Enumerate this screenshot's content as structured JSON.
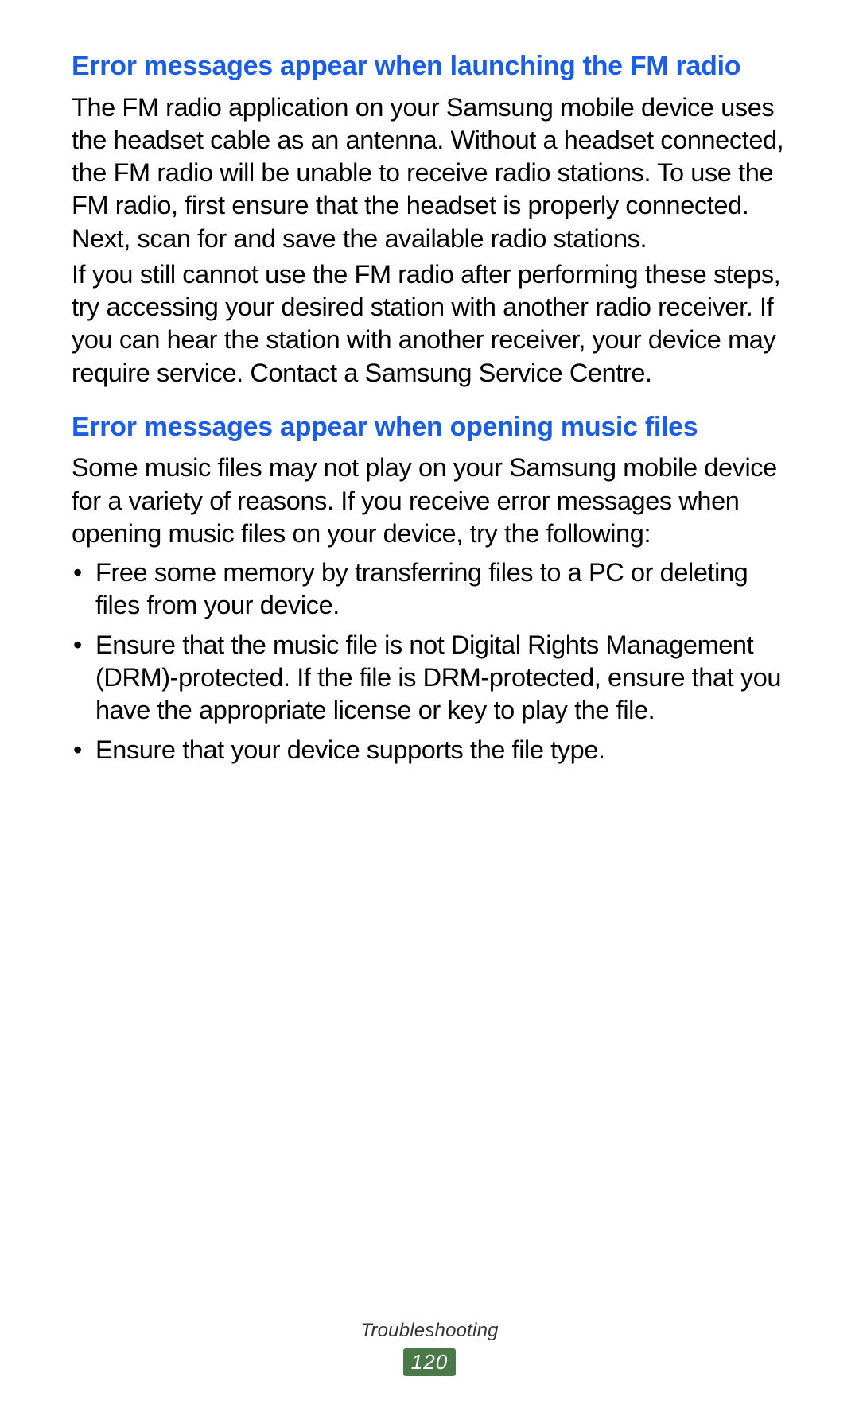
{
  "sections": [
    {
      "heading": "Error messages appear when launching the FM radio",
      "paragraphs": [
        "The FM radio application on your Samsung mobile device uses the headset cable as an antenna. Without a headset connected, the FM radio will be unable to receive radio stations. To use the FM radio, first ensure that the headset is properly connected. Next, scan for and save the available radio stations.",
        "If you still cannot use the FM radio after performing these steps, try accessing your desired station with another radio receiver. If you can hear the station with another receiver, your device may require service. Contact a Samsung Service Centre."
      ]
    },
    {
      "heading": "Error messages appear when opening music files",
      "paragraphs": [
        "Some music files may not play on your Samsung mobile device for a variety of reasons. If you receive error messages when opening music files on your device, try the following:"
      ],
      "bullets": [
        "Free some memory by transferring files to a PC or deleting files from your device.",
        "Ensure that the music file is not Digital Rights Management (DRM)-protected. If the file is DRM-protected, ensure that you have the appropriate license or key to play the file.",
        "Ensure that your device supports the file type."
      ]
    }
  ],
  "footer": {
    "label": "Troubleshooting",
    "page": "120"
  }
}
